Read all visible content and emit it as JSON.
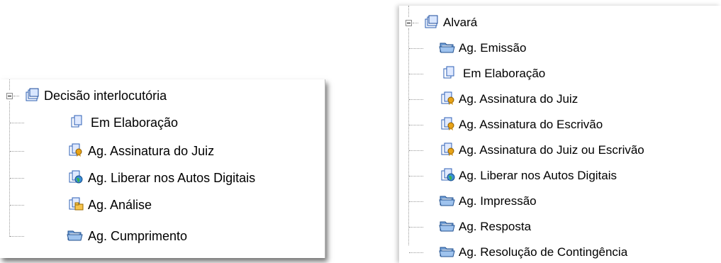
{
  "left_tree": {
    "root": {
      "label": "Decisão interlocutória",
      "icon": "folder-document-icon"
    },
    "children": [
      {
        "label": "Em Elaboração",
        "icon": "document-copies-icon"
      },
      {
        "label": "Ag. Assinatura do Juiz",
        "icon": "document-seal-icon"
      },
      {
        "label": "Ag. Liberar nos Autos Digitais",
        "icon": "document-globe-icon"
      },
      {
        "label": "Ag. Análise",
        "icon": "document-folder-icon"
      },
      {
        "label": "Ag. Cumprimento",
        "icon": "open-folder-icon"
      }
    ]
  },
  "right_tree": {
    "root": {
      "label": "Alvará",
      "icon": "folder-document-icon"
    },
    "children": [
      {
        "label": "Ag. Emissão",
        "icon": "open-folder-icon"
      },
      {
        "label": "Em Elaboração",
        "icon": "document-copies-icon"
      },
      {
        "label": "Ag. Assinatura do Juiz",
        "icon": "document-seal-icon"
      },
      {
        "label": "Ag. Assinatura do Escrivão",
        "icon": "document-seal-icon"
      },
      {
        "label": "Ag. Assinatura do Juiz ou Escrivão",
        "icon": "document-seal-icon"
      },
      {
        "label": "Ag. Liberar nos Autos Digitais",
        "icon": "document-globe-icon"
      },
      {
        "label": "Ag. Impressão",
        "icon": "open-folder-icon"
      },
      {
        "label": "Ag. Resposta",
        "icon": "open-folder-icon"
      },
      {
        "label": "Ag. Resolução de Contingência",
        "icon": "open-folder-icon"
      }
    ]
  }
}
